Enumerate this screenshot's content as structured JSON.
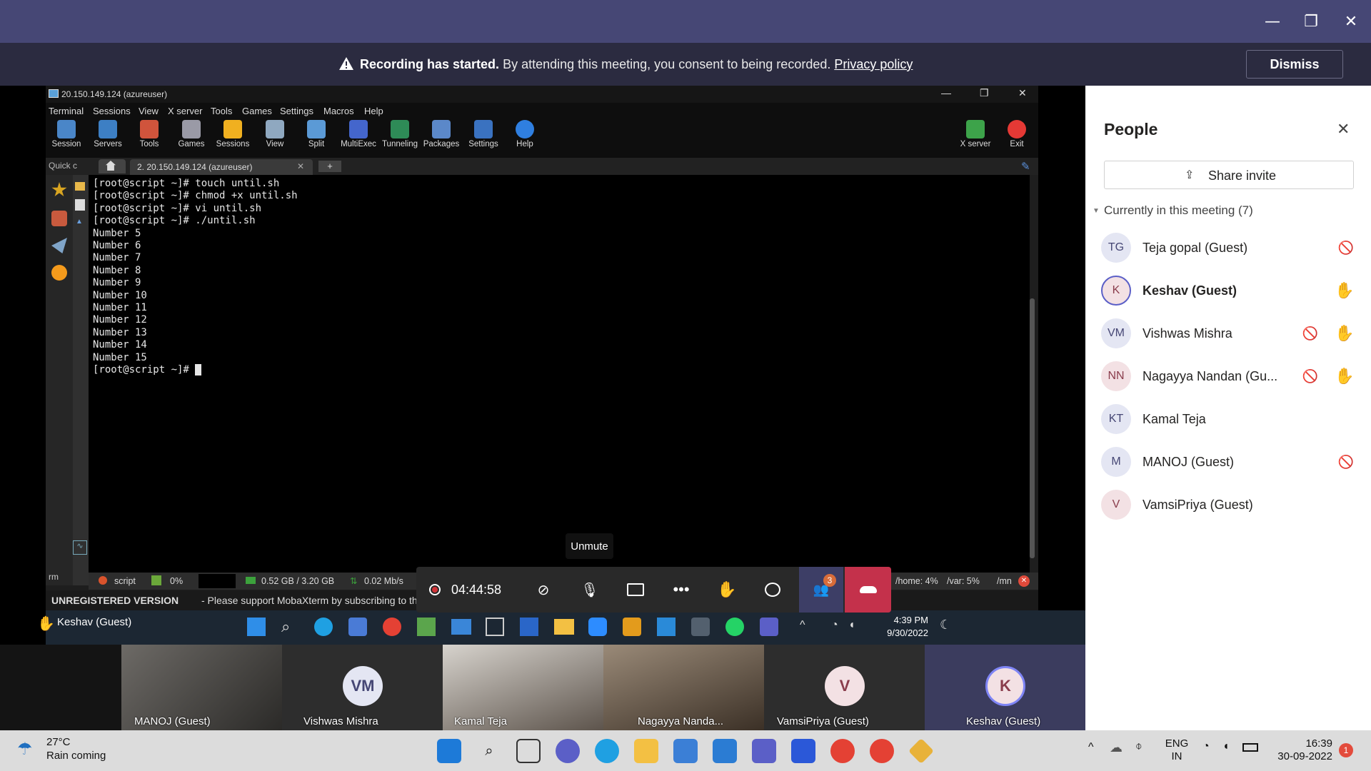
{
  "window_controls": {
    "minimize": "—",
    "maximize": "❐",
    "close": "✕"
  },
  "banner": {
    "title": "Recording has started.",
    "message": "By attending this meeting, you consent to being recorded.",
    "link": "Privacy policy",
    "dismiss": "Dismiss"
  },
  "moba": {
    "title": "20.150.149.124 (azureuser)",
    "menu": [
      "Terminal",
      "Sessions",
      "View",
      "X server",
      "Tools",
      "Games",
      "Settings",
      "Macros",
      "Help"
    ],
    "toolbar": [
      "Session",
      "Servers",
      "Tools",
      "Games",
      "Sessions",
      "View",
      "Split",
      "MultiExec",
      "Tunneling",
      "Packages",
      "Settings",
      "Help"
    ],
    "toolbar_right": [
      "X server",
      "Exit"
    ],
    "quick": "Quick c",
    "tab": "2. 20.150.149.124 (azureuser)",
    "terminal_lines": [
      "[root@script ~]# touch until.sh",
      "[root@script ~]# chmod +x until.sh",
      "[root@script ~]# vi until.sh",
      "[root@script ~]# ./until.sh",
      "Number 5",
      "Number 6",
      "Number 7",
      "Number 8",
      "Number 9",
      "Number 10",
      "Number 11",
      "Number 12",
      "Number 13",
      "Number 14",
      "Number 15"
    ],
    "prompt": "[root@script ~]# ",
    "status": {
      "host": "script",
      "cpu": "0%",
      "mem": "0.52 GB / 3.20 GB",
      "net": "0.02 Mb/s",
      "home": "/home: 4%",
      "var": "/var: 5%",
      "mnt": "/mn"
    },
    "sidebar_label": "rm",
    "unregistered": "UNREGISTERED VERSION",
    "unreg_msg": "-  Please support MobaXterm by subscribing to the"
  },
  "vm_taskbar": {
    "presenter": "Keshav (Guest)",
    "time": "4:39 PM",
    "date": "9/30/2022"
  },
  "callbar": {
    "timer": "04:44:58",
    "tooltip": "Unmute",
    "people_badge": "3"
  },
  "people": {
    "title": "People",
    "share": "Share invite",
    "section": "Currently in this meeting (7)",
    "list": [
      {
        "initials": "TG",
        "name": "Teja gopal (Guest)",
        "muted": true,
        "hand": false
      },
      {
        "initials": "K",
        "name": "Keshav (Guest)",
        "muted": false,
        "hand": true,
        "bold": true
      },
      {
        "initials": "VM",
        "name": "Vishwas Mishra",
        "muted": true,
        "hand": true
      },
      {
        "initials": "NN",
        "name": "Nagayya Nandan (Gu...",
        "muted": true,
        "hand": true
      },
      {
        "initials": "KT",
        "name": "Kamal Teja",
        "muted": false,
        "hand": false
      },
      {
        "initials": "M",
        "name": "MANOJ (Guest)",
        "muted": true,
        "hand": false
      },
      {
        "initials": "V",
        "name": "VamsiPriya (Guest)",
        "muted": false,
        "hand": false
      }
    ]
  },
  "gallery": [
    {
      "name": "MANOJ (Guest)"
    },
    {
      "name": "Vishwas Mishra",
      "initials": "VM"
    },
    {
      "name": "Kamal Teja"
    },
    {
      "name": "Nagayya Nanda..."
    },
    {
      "name": "VamsiPriya (Guest)",
      "initials": "V"
    },
    {
      "name": "Keshav (Guest)",
      "initials": "K"
    }
  ],
  "weather": {
    "temp": "27°C",
    "desc": "Rain coming"
  },
  "tray": {
    "lang1": "ENG",
    "lang2": "IN",
    "time": "16:39",
    "date": "30-09-2022",
    "notif": "1"
  }
}
